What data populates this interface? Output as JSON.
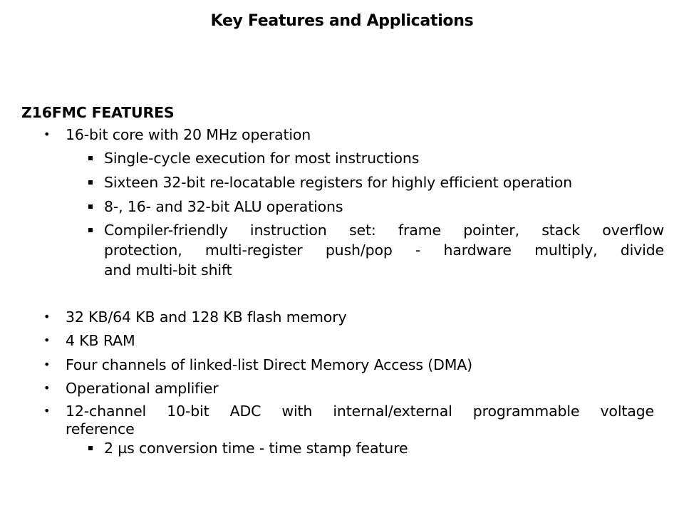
{
  "slide": {
    "title": "Key Features and Applications",
    "heading": "Z16FMC FEATURES",
    "items": [
      {
        "text": "16-bit core with 20 MHz operation",
        "subitems": [
          "Single-cycle execution for most instructions",
          "Sixteen 32-bit re-locatable registers for highly efficient operation",
          "8-, 16- and 32-bit ALU operations",
          {
            "lines": [
              "Compiler-friendly instruction set: frame pointer, stack overflow",
              "protection, multi-register push/pop - hardware multiply, divide",
              "and multi-bit shift"
            ]
          }
        ]
      },
      {
        "text": "32 KB/64 KB and 128 KB flash memory"
      },
      {
        "text": "4 KB RAM"
      },
      {
        "text": "Four channels of linked-list Direct Memory Access (DMA)"
      },
      {
        "text": "Operational amplifier"
      },
      {
        "lines": [
          "12-channel 10-bit ADC with internal/external programmable voltage",
          "reference"
        ],
        "subitems": [
          "2 µs conversion time - time stamp feature"
        ]
      }
    ]
  }
}
